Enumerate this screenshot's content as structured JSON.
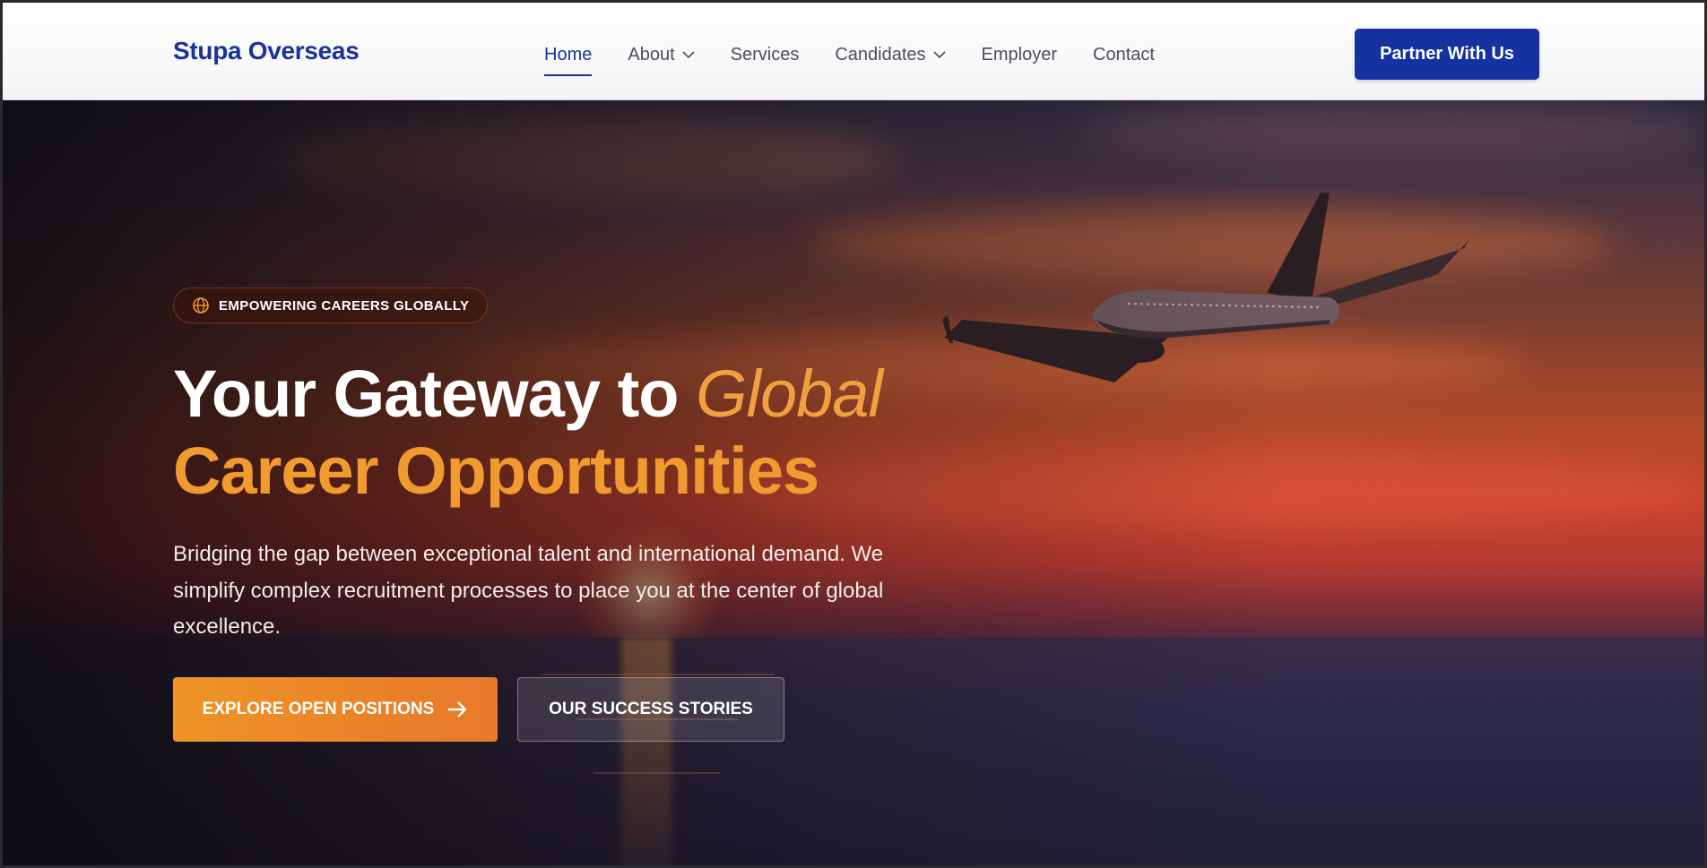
{
  "header": {
    "logo": "Stupa Overseas",
    "nav": [
      {
        "label": "Home"
      },
      {
        "label": "About"
      },
      {
        "label": "Services"
      },
      {
        "label": "Candidates"
      },
      {
        "label": "Employer"
      },
      {
        "label": "Contact"
      }
    ],
    "cta_label": "Partner With Us"
  },
  "hero": {
    "badge": {
      "icon": "globe-icon",
      "text": "EMPOWERING CAREERS GLOBALLY"
    },
    "headline": {
      "part1": "Your Gateway to ",
      "italic": "Global",
      "part2": "Career Opportunities"
    },
    "subtext": "Bridging the gap between exceptional talent and international demand. We simplify complex recruitment processes to place you at the center of global excellence.",
    "primary_button": {
      "label": "EXPLORE OPEN POSITIONS",
      "icon": "arrow-right-icon"
    },
    "secondary_button": {
      "label": "OUR SUCCESS STORIES"
    }
  },
  "colors": {
    "brand_blue": "#1432a0",
    "accent_orange": "#f09a30"
  }
}
